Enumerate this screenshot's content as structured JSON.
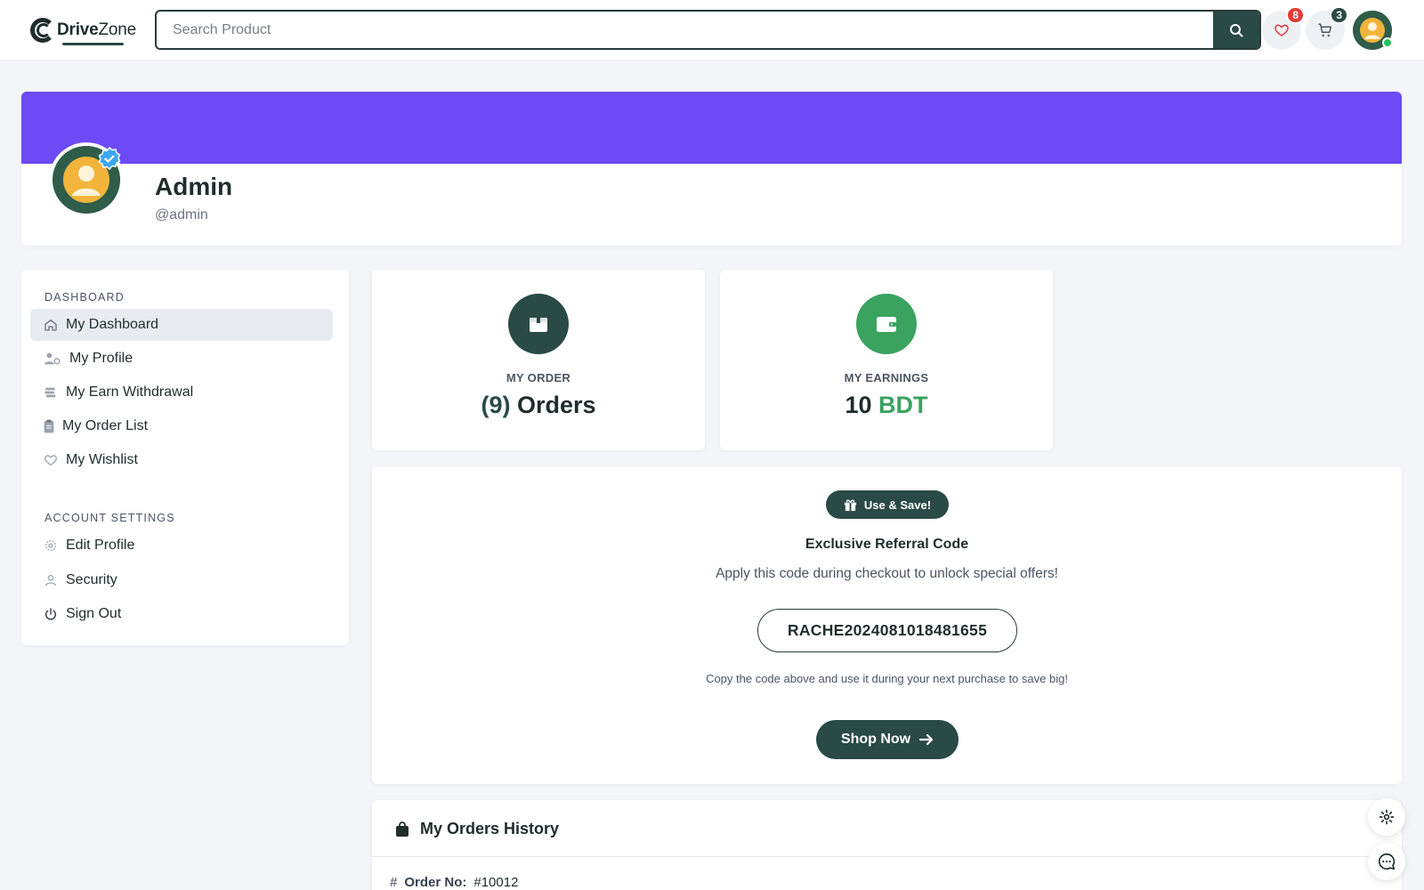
{
  "header": {
    "logo_brand": "Drive",
    "logo_brand_suffix": "Zone",
    "search_placeholder": "Search Product",
    "wishlist_count": "8",
    "cart_count": "3",
    "icons": {
      "search": "search-icon",
      "wishlist": "heart-icon",
      "cart": "cart-icon"
    }
  },
  "profile": {
    "name": "Admin",
    "handle": "@admin",
    "cover_color": "#6c4bf6",
    "verified": true
  },
  "sidebar": {
    "dashboard_heading": "DASHBOARD",
    "dashboard_items": [
      {
        "label": "My Dashboard",
        "icon": "home-icon",
        "active": true
      },
      {
        "label": "My Profile",
        "icon": "user-cog-icon",
        "active": false
      },
      {
        "label": "My Earn Withdrawal",
        "icon": "coins-icon",
        "active": false
      },
      {
        "label": "My Order List",
        "icon": "clipboard-icon",
        "active": false
      },
      {
        "label": "My Wishlist",
        "icon": "heart-icon",
        "active": false
      }
    ],
    "settings_heading": "ACCOUNT SETTINGS",
    "settings_items": [
      {
        "label": "Edit Profile",
        "icon": "gear-icon"
      },
      {
        "label": "Security",
        "icon": "user-icon"
      },
      {
        "label": "Sign Out",
        "icon": "power-icon"
      }
    ]
  },
  "stats": {
    "order": {
      "label": "MY ORDER",
      "count": "(9)",
      "unit": "Orders",
      "icon": "box-icon",
      "color": "#2a4a45"
    },
    "earnings": {
      "label": "MY EARNINGS",
      "amount": "10",
      "currency": "BDT",
      "icon": "wallet-icon",
      "color": "#3aa35f"
    }
  },
  "referral": {
    "pill_label": "Use & Save!",
    "title": "Exclusive Referral Code",
    "subtitle": "Apply this code during checkout to unlock special offers!",
    "code": "RACHE2024081018481655",
    "note": "Copy the code above and use it during your next purchase to save big!",
    "button_label": "Shop Now"
  },
  "orders_history": {
    "title": "My Orders History",
    "order_no_label": "Order No:",
    "order_no_value": "#10012"
  },
  "colors": {
    "primary": "#2a4a45",
    "accent_green": "#3aa35f",
    "badge_red": "#e53935",
    "cover_purple": "#6c4bf6"
  }
}
